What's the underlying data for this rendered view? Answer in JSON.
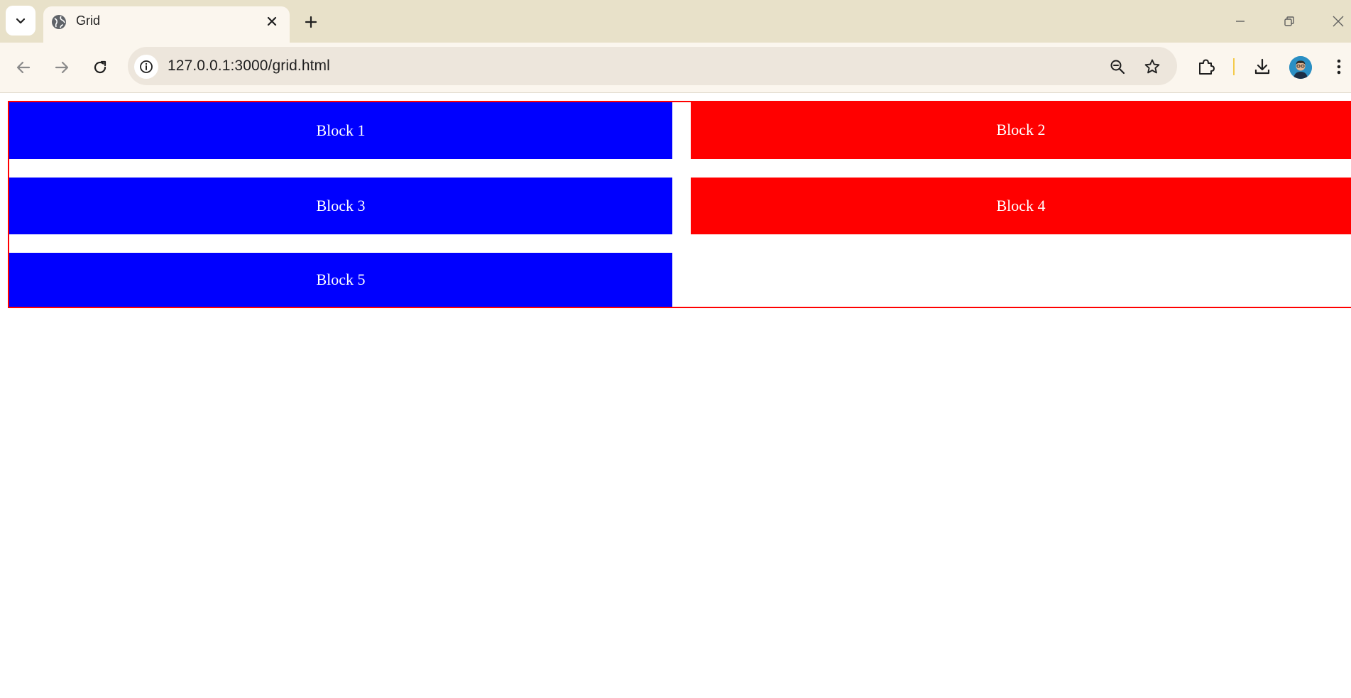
{
  "browser": {
    "tab": {
      "title": "Grid",
      "favicon": "globe-icon"
    },
    "new_tab_icon": "plus-icon",
    "url": "127.0.0.1:3000/grid.html",
    "window_controls": [
      "minimize-icon",
      "restore-icon",
      "close-icon"
    ],
    "toolbar_icons": [
      "back-arrow-icon",
      "forward-arrow-icon",
      "reload-icon",
      "site-info-icon",
      "zoom-out-icon",
      "star-icon",
      "extensions-icon",
      "download-icon",
      "avatar",
      "kebab-menu-icon"
    ]
  },
  "grid": {
    "border_color": "#ff0000",
    "blocks": [
      {
        "label": "Block 1",
        "color": "#0000ff"
      },
      {
        "label": "Block 2",
        "color": "#ff0000"
      },
      {
        "label": "Block 3",
        "color": "#0000ff"
      },
      {
        "label": "Block 4",
        "color": "#ff0000"
      },
      {
        "label": "Block 5",
        "color": "#0000ff"
      }
    ]
  }
}
